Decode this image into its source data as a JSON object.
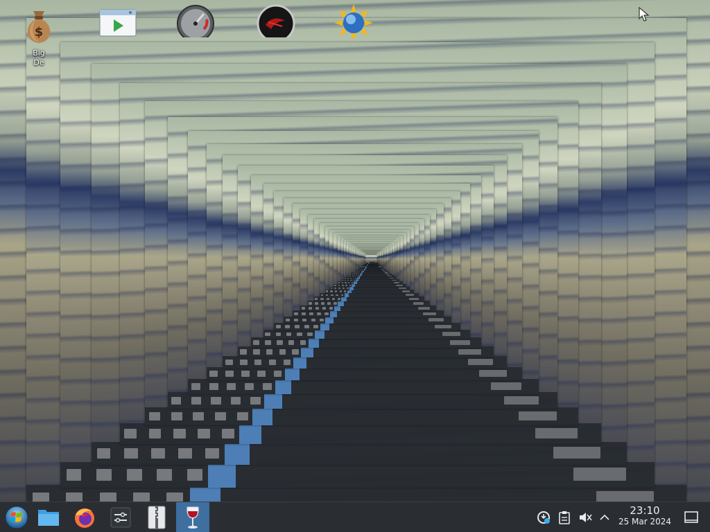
{
  "desktop": {
    "icons": [
      {
        "name": "money-bag-icon",
        "label": "Big\nDe"
      },
      {
        "name": "media-player-icon",
        "label": ""
      },
      {
        "name": "speedometer-icon",
        "label": ""
      },
      {
        "name": "red-disc-icon",
        "label": ""
      },
      {
        "name": "globe-sun-icon",
        "label": ""
      }
    ]
  },
  "taskbar": {
    "start_icon": "windows-start-icon",
    "pinned": [
      {
        "name": "file-manager-icon",
        "active": false
      },
      {
        "name": "firefox-icon",
        "active": false
      },
      {
        "name": "settings-mixer-icon",
        "active": false
      },
      {
        "name": "archive-zipper-icon",
        "active": false
      },
      {
        "name": "wine-glass-icon",
        "active": true
      }
    ],
    "tray": [
      {
        "name": "updates-icon"
      },
      {
        "name": "clipboard-icon"
      },
      {
        "name": "volume-muted-icon"
      },
      {
        "name": "chevron-up-icon"
      }
    ],
    "clock": {
      "time": "23:10",
      "date": "25 Mar 2024"
    },
    "show_desktop_icon": "show-desktop-icon"
  },
  "colors": {
    "taskbar_bg": "#2a2e32",
    "active_task": "#3e6f9f",
    "text": "#eef0f1"
  }
}
